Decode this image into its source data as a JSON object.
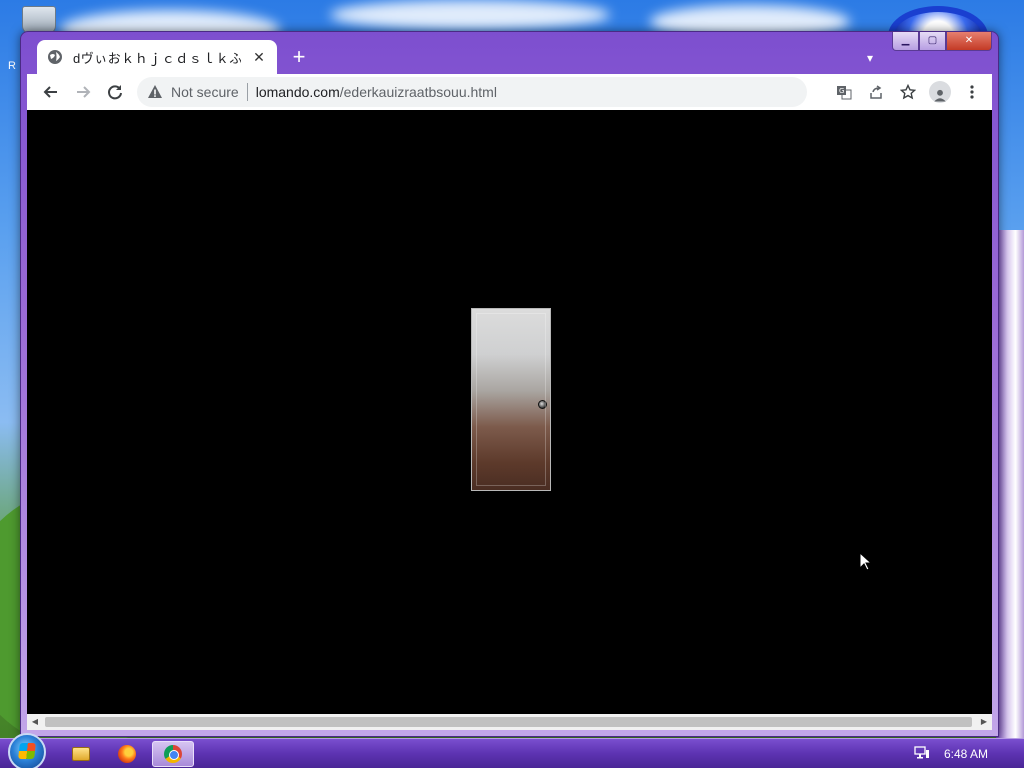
{
  "browser": {
    "tab": {
      "title": "dヴぃおｋｈｊｃｄｓｌｋふぇ",
      "icon": "globe-icon"
    },
    "address": {
      "security": "Not secure",
      "domain": "lomando.com",
      "path": "/ederkauizraatbsouu.html"
    },
    "toolbar_icons": [
      "back-arrow-icon",
      "forward-arrow-icon",
      "reload-icon",
      "translate-icon",
      "share-icon",
      "star-icon",
      "profile-icon",
      "menu-dots-icon"
    ],
    "page": {
      "background": "#000000",
      "content": "door-image"
    }
  },
  "window_buttons": [
    "minimize",
    "maximize",
    "close"
  ],
  "taskbar": {
    "apps": [
      "file-explorer",
      "firefox",
      "chrome"
    ],
    "active_app": "chrome",
    "clock": "6:48 AM"
  },
  "colors": {
    "window_frame": "#7d4fcf",
    "taskbar": "#5d33b2",
    "page_background": "#000000"
  }
}
